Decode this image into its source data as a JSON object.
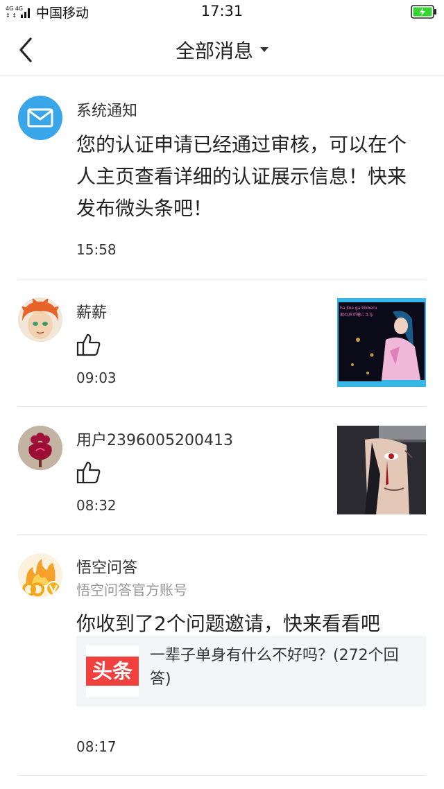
{
  "status_bar": {
    "network": "4G 4G",
    "carrier": "中国移动",
    "time": "17:31"
  },
  "header": {
    "back_icon": "chevron-left-icon",
    "title": "全部消息"
  },
  "messages": [
    {
      "sender": "系统通知",
      "avatar_icon": "mail-icon",
      "text": "您的认证申请已经通过审核，可以在个人主页查看详细的认证展示信息！快来发布微头条吧！",
      "time": "15:58"
    },
    {
      "sender": "薪薪",
      "action_icon": "thumbs-up-icon",
      "time": "09:03",
      "thumb_overlay_line1": "ha koe ga kikoeru",
      "thumb_overlay_line2": "君の声が聴こえる"
    },
    {
      "sender": "用户2396005200413",
      "action_icon": "thumbs-up-icon",
      "time": "08:32"
    },
    {
      "sender": "悟空问答",
      "subtitle": "悟空问答官方账号",
      "text": "你收到了2个问题邀请，快来看看吧",
      "card": {
        "logo_text": "头条",
        "title": "一辈子单身有什么不好吗？(272个回答)"
      },
      "time": "08:17"
    }
  ],
  "colors": {
    "mail_avatar": "#3aa6ea",
    "toutiao_red": "#f1413f",
    "battery_green": "#37d434"
  }
}
